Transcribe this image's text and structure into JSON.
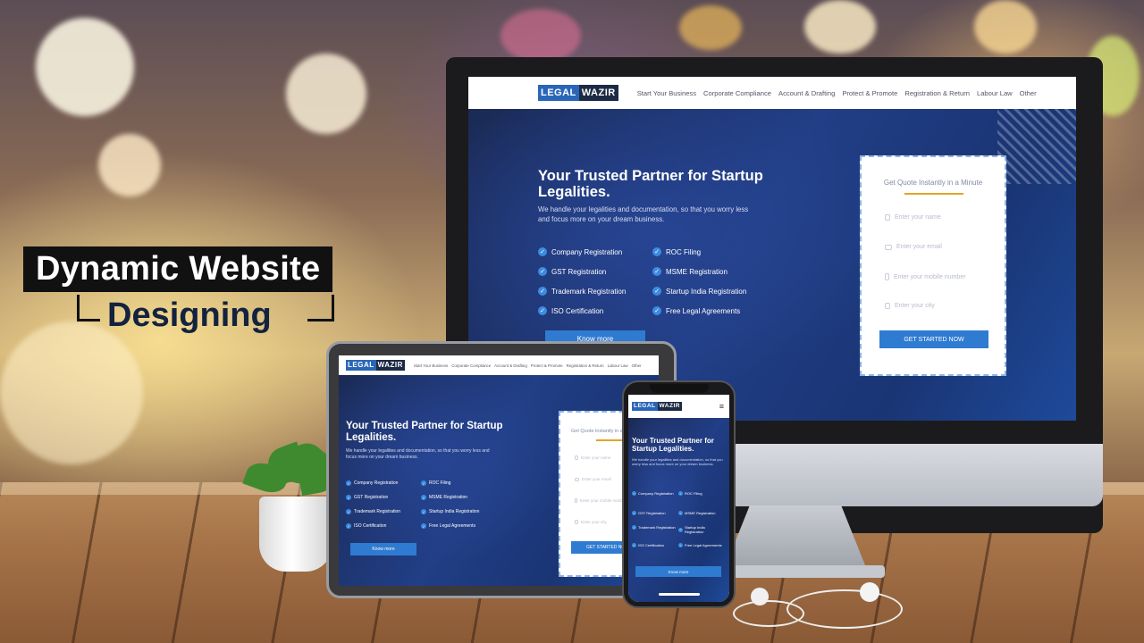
{
  "headline": {
    "line1": "Dynamic Website",
    "line2": "Designing"
  },
  "site": {
    "logo": {
      "part1": "LEGAL",
      "part2": "WAZIR"
    },
    "nav": [
      "Start Your Business",
      "Corporate Compliance",
      "Account & Drafting",
      "Protect & Promote",
      "Registration & Return",
      "Labour Law",
      "Other"
    ],
    "hero_title": "Your Trusted Partner for Startup Legalities.",
    "hero_subtitle": "We handle your legalities and documentation, so that you worry less and focus more on your dream business.",
    "features": [
      "Company Registration",
      "ROC Filing",
      "GST Registration",
      "MSME Registration",
      "Trademark Registration",
      "Startup India Registration",
      "ISO Certification",
      "Free Legal Agreements"
    ],
    "know_more": "Know more",
    "form": {
      "title": "Get Quote Instantly in a Minute",
      "fields": [
        "Enter your name",
        "Enter your email",
        "Enter your mobile number",
        "Enter your city"
      ],
      "submit": "GET STARTED NOW"
    }
  },
  "colors": {
    "brand_blue": "#2a66b8",
    "hero_dark": "#1b2a55",
    "button": "#2f7bd1",
    "accent": "#e1a428"
  }
}
